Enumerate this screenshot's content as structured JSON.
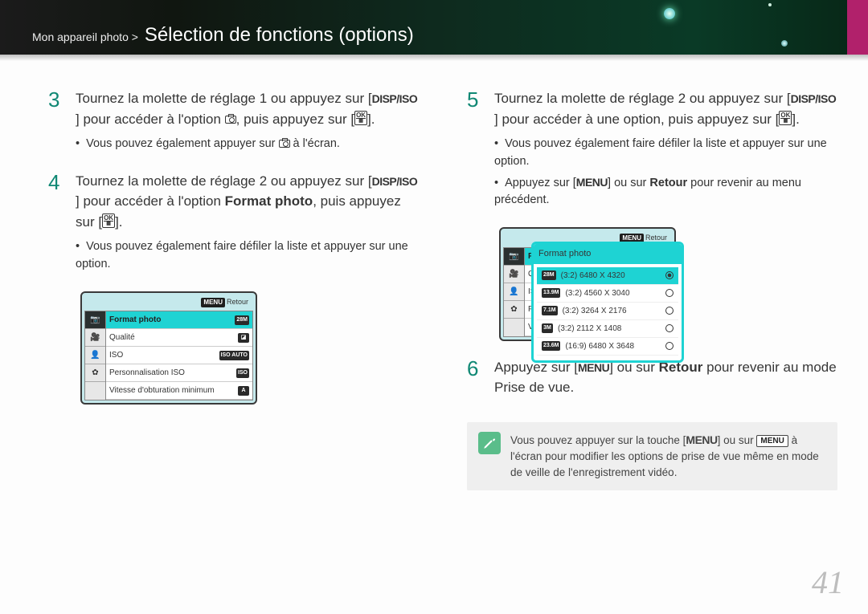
{
  "header": {
    "breadcrumb_prefix": "Mon appareil photo >",
    "title": "Sélection de fonctions (options)"
  },
  "left": {
    "step3": {
      "part1": "Tournez la molette de réglage 1 ou appuyez sur [",
      "disp": "DISP/ISO",
      "part2": "] pour accéder à l'option ",
      "part3": ", puis appuyez sur [",
      "part4": "].",
      "bullet1a": "Vous pouvez également appuyer sur ",
      "bullet1b": " à l'écran."
    },
    "step4": {
      "part1": "Tournez la molette de réglage 2 ou appuyez sur [",
      "disp": "DISP/ISO",
      "part2": "] pour accéder à l'option ",
      "bold": "Format photo",
      "part3": ", puis appuyez sur [",
      "part4": "].",
      "bullet": "Vous pouvez également faire défiler la liste et appuyer sur une option."
    },
    "lcd": {
      "retour": "Retour",
      "rows": [
        {
          "label": "Format photo",
          "badge": "28M",
          "active": true
        },
        {
          "label": "Qualité",
          "badge": "◪"
        },
        {
          "label": "ISO",
          "badge": "ISO\nAUTO"
        },
        {
          "label": "Personnalisation ISO",
          "badge": "ISO"
        },
        {
          "label": "Vitesse d'obturation minimum",
          "badge": "A"
        }
      ]
    }
  },
  "right": {
    "step5": {
      "part1": "Tournez la molette de réglage 2 ou appuyez sur [",
      "disp": "DISP/ISO",
      "part2": "] pour accéder à une option, puis appuyez sur [",
      "part3": "].",
      "bullet1": "Vous pouvez également faire défiler la liste et appuyer sur une option.",
      "bullet2a": "Appuyez sur [",
      "bullet2_menu": "MENU",
      "bullet2b": "] ou sur ",
      "bullet2_bold": "Retour",
      "bullet2c": " pour revenir au menu précédent."
    },
    "lcd_under": {
      "rows": [
        "Form",
        "Quali",
        "ISO",
        "Perso",
        "Vites"
      ]
    },
    "lcd_overlay": {
      "title": "Format photo",
      "options": [
        {
          "badge": "28M",
          "label": "(3:2) 6480 X 4320",
          "sel": true
        },
        {
          "badge": "13.9M",
          "label": "(3:2) 4560 X 3040"
        },
        {
          "badge": "7.1M",
          "label": "(3:2) 3264 X 2176"
        },
        {
          "badge": "3M",
          "label": "(3:2) 2112 X 1408"
        },
        {
          "badge": "23.6M",
          "label": "(16:9) 6480 X 3648"
        }
      ]
    },
    "step6": {
      "part1": "Appuyez sur [",
      "menu": "MENU",
      "part2": "] ou sur ",
      "bold": "Retour",
      "part3": " pour revenir au mode Prise de vue."
    },
    "note": {
      "part1": "Vous pouvez appuyer sur la touche [",
      "menu1": "MENU",
      "part2": "] ou sur ",
      "menu2": "MENU",
      "part3": " à l'écran pour modifier les options de prise de vue même en mode de veille de l'enregistrement vidéo."
    }
  },
  "page_number": "41"
}
